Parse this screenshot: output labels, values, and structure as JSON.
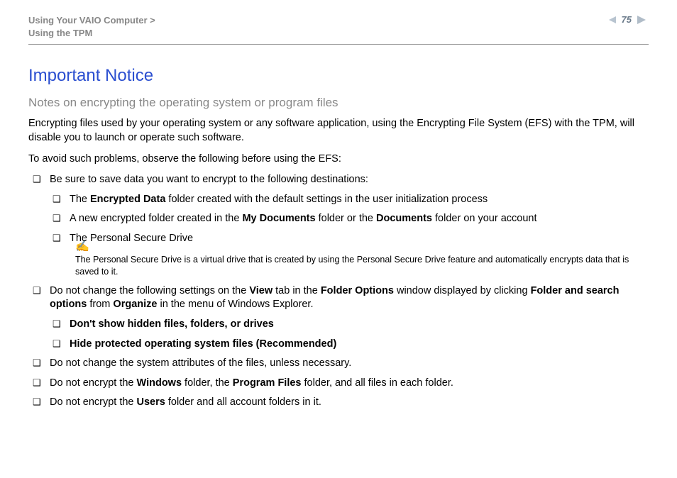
{
  "header": {
    "breadcrumb_line1": "Using Your VAIO Computer >",
    "breadcrumb_line2": "Using the TPM",
    "page_number": "75"
  },
  "title": "Important Notice",
  "subtitle": "Notes on encrypting the operating system or program files",
  "para1": "Encrypting files used by your operating system or any software application, using the Encrypting File System (EFS) with the TPM, will disable you to launch or operate such software.",
  "para2": "To avoid such problems, observe the following before using the EFS:",
  "bullets": {
    "b1": "Be sure to save data you want to encrypt to the following destinations:",
    "b1_sub": {
      "s1_pre": "The ",
      "s1_b": "Encrypted Data",
      "s1_post": " folder created with the default settings in the user initialization process",
      "s2_pre": "A new encrypted folder created in the ",
      "s2_b1": "My Documents",
      "s2_mid": " folder or the ",
      "s2_b2": "Documents",
      "s2_post": " folder on your account",
      "s3": "The Personal Secure Drive"
    },
    "note": "The Personal Secure Drive is a virtual drive that is created by using the Personal Secure Drive feature and automatically encrypts data that is saved to it.",
    "b2_pre": "Do not change the following settings on the ",
    "b2_b1": "View",
    "b2_m1": " tab in the ",
    "b2_b2": "Folder Options",
    "b2_m2": " window displayed by clicking ",
    "b2_b3": "Folder and search options",
    "b2_m3": " from ",
    "b2_b4": "Organize",
    "b2_post": " in the menu of Windows Explorer.",
    "b2_sub": {
      "s1": "Don't show hidden files, folders, or drives",
      "s2": "Hide protected operating system files (Recommended)"
    },
    "b3": "Do not change the system attributes of the files, unless necessary.",
    "b4_pre": "Do not encrypt the ",
    "b4_b1": "Windows",
    "b4_m1": " folder, the ",
    "b4_b2": "Program Files",
    "b4_post": " folder, and all files in each folder.",
    "b5_pre": "Do not encrypt the ",
    "b5_b1": "Users",
    "b5_post": " folder and all account folders in it."
  }
}
